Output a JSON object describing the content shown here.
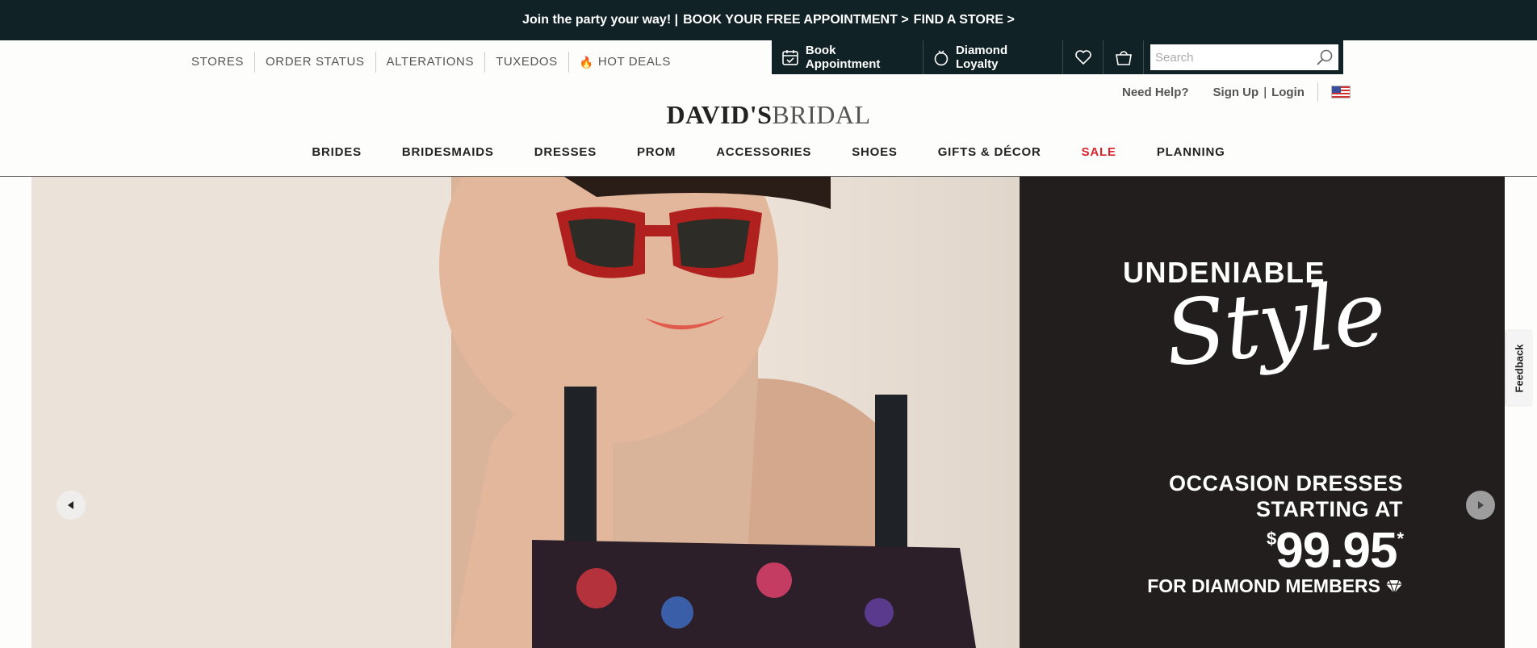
{
  "promo_bar": {
    "text": "Join the party your way! |",
    "book_link": "BOOK YOUR FREE APPOINTMENT >",
    "store_link": "FIND A STORE >"
  },
  "utility_nav": {
    "items": [
      "STORES",
      "ORDER STATUS",
      "ALTERATIONS",
      "TUXEDOS",
      "HOT DEALS"
    ]
  },
  "action_bar": {
    "book_appointment": "Book Appointment",
    "diamond_loyalty": "Diamond Loyalty",
    "search_placeholder": "Search"
  },
  "account": {
    "need_help": "Need Help?",
    "sign_up": "Sign Up",
    "separator": "|",
    "login": "Login"
  },
  "logo": {
    "part1": "DAVID'S",
    "part2": "BRIDAL"
  },
  "main_nav": {
    "items": [
      "BRIDES",
      "BRIDESMAIDS",
      "DRESSES",
      "PROM",
      "ACCESSORIES",
      "SHOES",
      "GIFTS & DÉCOR",
      "SALE",
      "PLANNING"
    ]
  },
  "hero": {
    "headline": "UNDENIABLE",
    "script": "Style",
    "line1": "OCCASION DRESSES",
    "line2": "STARTING AT",
    "currency": "$",
    "price": "99.95",
    "asterisk": "*",
    "members": "FOR DIAMOND MEMBERS"
  },
  "feedback": {
    "label": "Feedback"
  }
}
